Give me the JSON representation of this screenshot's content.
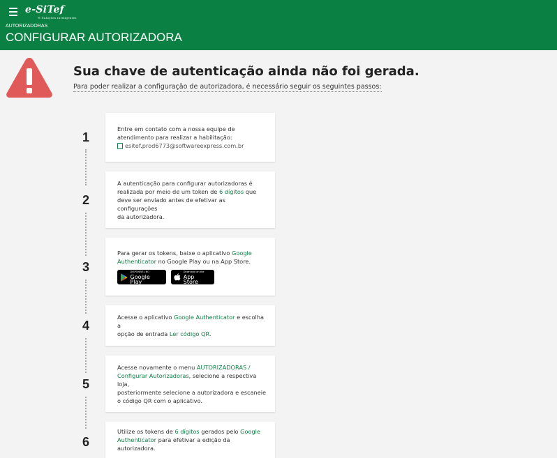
{
  "header": {
    "logo_text": "e-SiTef",
    "logo_tagline": "® Soluções Inteligentes",
    "breadcrumb": "AUTORIZADORAS",
    "title": "CONFIGURAR AUTORIZADORA",
    "brand_color": "#0b8043"
  },
  "alert": {
    "icon": "warning-triangle-icon",
    "icon_color": "#e05a5a",
    "title": "Sua chave de autenticação ainda não foi gerada.",
    "subtitle": "Para poder realizar a configuração de autorizadora, é necessário seguir os seguintes passos:"
  },
  "steps": [
    {
      "number": "1",
      "line1": "Entre em contato com a nossa equipe de",
      "line2": "atendimento para realizar a habilitação:",
      "email": "esitef.prod6773@softwareexpress.com.br"
    },
    {
      "number": "2",
      "t1": "A autenticação para configurar autorizadoras é",
      "t2": "realizada por meio de um token de ",
      "hl": "6 dígitos",
      "t3": " que",
      "t4": "deve ser enviado antes de efetivar as configurações",
      "t5": "da autorizadora."
    },
    {
      "number": "3",
      "t1": "Para gerar os tokens, baixe o aplicativo ",
      "hl1": "Google",
      "hl2": "Authenticator",
      "t2": " no Google Play ou na App Store.",
      "google_play_small": "DISPONÍVEL NO",
      "google_play": "Google Play",
      "app_store_small": "Download on the",
      "app_store": "App Store"
    },
    {
      "number": "4",
      "t1": "Acesse o aplicativo ",
      "hl1": "Google Authenticator",
      "t2": " e escolha a",
      "t3": "opção de entrada ",
      "hl2": "Ler código QR",
      "t4": "."
    },
    {
      "number": "5",
      "t1": "Acesse novamente o menu ",
      "hl1": "AUTORIZADORAS /",
      "hl2": "Configurar Autorizadoras",
      "t2": ", selecione a respectiva loja,",
      "t3": "posteriormente selecione a autorizadora e escaneie",
      "t4": "o código QR com o aplicativo."
    },
    {
      "number": "6",
      "t1": "Utilize os tokens de ",
      "hl1": "6 dígitos",
      "t2": " gerados pelo ",
      "hl2": "Google",
      "hl3": "Authenticator",
      "t3": " para efetivar a edição da autorizadora."
    }
  ]
}
